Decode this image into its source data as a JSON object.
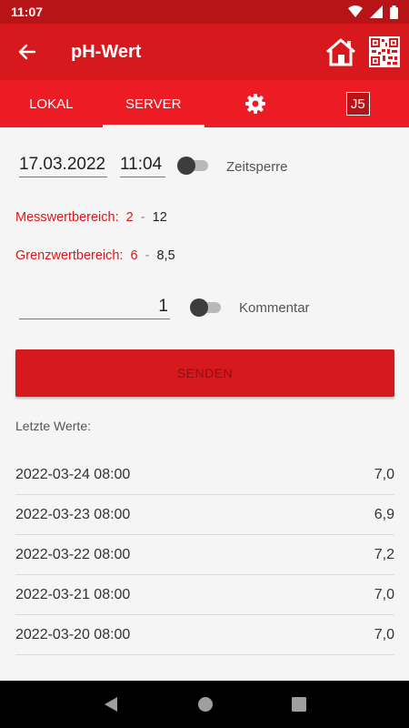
{
  "status_bar": {
    "time": "11:07"
  },
  "app_bar": {
    "title": "pH-Wert"
  },
  "tabs": [
    {
      "label": "LOKAL"
    },
    {
      "label": "SERVER"
    },
    {
      "label": "gear-icon"
    },
    {
      "label": "J5"
    }
  ],
  "form": {
    "date": "17.03.2022",
    "time": "11:04",
    "lock_label": "Zeitsperre",
    "measure_range_label": "Messwertbereich:",
    "measure_min": "2",
    "measure_sep": "-",
    "measure_max": "12",
    "limit_range_label": "Grenzwertbereich:",
    "limit_min": "6",
    "limit_sep": "-",
    "limit_max": "8,5",
    "value": "1",
    "comment_label": "Kommentar",
    "send_label": "SENDEN"
  },
  "last_values": {
    "label": "Letzte Werte:",
    "rows": [
      {
        "date": "2022-03-24 08:00",
        "value": "7,0"
      },
      {
        "date": "2022-03-23 08:00",
        "value": "6,9"
      },
      {
        "date": "2022-03-22 08:00",
        "value": "7,2"
      },
      {
        "date": "2022-03-21 08:00",
        "value": "7,0"
      },
      {
        "date": "2022-03-20 08:00",
        "value": "7,0"
      }
    ]
  },
  "colors": {
    "primary": "#d7181c",
    "tab_bar": "#ed1c24",
    "status_bar": "#b81418",
    "accent_text": "#e0161d"
  }
}
